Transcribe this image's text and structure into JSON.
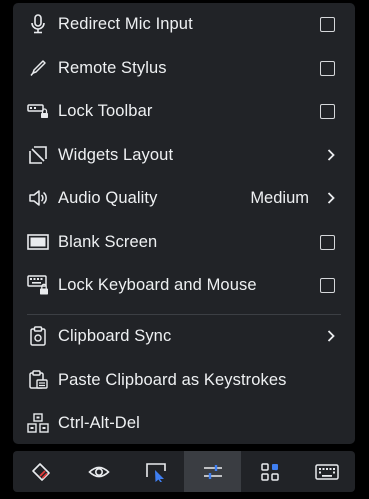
{
  "menu": {
    "items": [
      {
        "label": "Redirect Mic Input",
        "icon": "microphone-icon",
        "control": "checkbox",
        "checked": false
      },
      {
        "label": "Remote Stylus",
        "icon": "stylus-icon",
        "control": "checkbox",
        "checked": false
      },
      {
        "label": "Lock Toolbar",
        "icon": "lock-toolbar-icon",
        "control": "checkbox",
        "checked": false
      },
      {
        "label": "Widgets Layout",
        "icon": "widgets-layout-icon",
        "control": "chevron"
      },
      {
        "label": "Audio Quality",
        "value": "Medium",
        "icon": "speaker-icon",
        "control": "chevron"
      },
      {
        "label": "Blank Screen",
        "icon": "blank-screen-icon",
        "control": "checkbox",
        "checked": false
      },
      {
        "label": "Lock Keyboard and Mouse",
        "icon": "lock-keyboard-icon",
        "control": "checkbox",
        "checked": false
      },
      {
        "label": "Clipboard Sync",
        "icon": "clipboard-icon",
        "control": "chevron"
      },
      {
        "label": "Paste Clipboard as Keystrokes",
        "icon": "paste-clipboard-icon",
        "control": "none"
      },
      {
        "label": "Ctrl-Alt-Del",
        "icon": "ctrl-alt-del-icon",
        "control": "none"
      }
    ]
  },
  "toolbar": {
    "buttons": [
      {
        "icon": "eraser-pen-icon"
      },
      {
        "icon": "eye-icon"
      },
      {
        "icon": "pointer-select-icon"
      },
      {
        "icon": "sliders-icon",
        "active": true
      },
      {
        "icon": "widgets-grid-icon"
      },
      {
        "icon": "keyboard-icon"
      }
    ]
  },
  "colors": {
    "panel_bg": "#212327",
    "text": "#eef0f2",
    "accent_red": "#e23b3b",
    "accent_blue": "#3f7ff2"
  }
}
